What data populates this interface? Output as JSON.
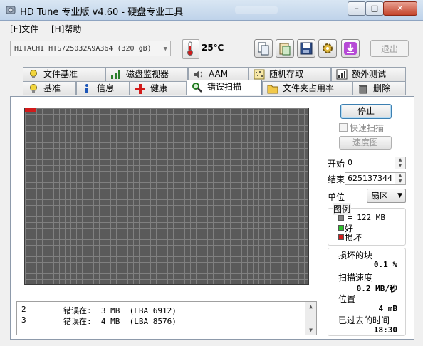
{
  "window": {
    "title": "HD Tune 专业版 v4.60 - 硬盘专业工具",
    "close_label": "✕",
    "min_label": "–",
    "max_label": "□"
  },
  "menu": [
    "[F]文件",
    "[H]帮助"
  ],
  "toolbar": {
    "drive": "HITACHI HTS725032A9A364  (320 gB)",
    "temperature": "25℃",
    "exit_label": "退出",
    "buttons": [
      {
        "icon": "copy-icon"
      },
      {
        "icon": "paste-icon"
      },
      {
        "icon": "save-icon"
      },
      {
        "icon": "options-icon"
      },
      {
        "icon": "download-icon"
      }
    ]
  },
  "tabs_top": [
    {
      "label": "文件基准",
      "icon": "info-bulb-icon"
    },
    {
      "label": "磁盘监视器",
      "icon": "monitor-chart-icon"
    },
    {
      "label": "AAM",
      "icon": "speaker-icon"
    },
    {
      "label": "随机存取",
      "icon": "random-access-icon"
    },
    {
      "label": "额外测试",
      "icon": "extra-tests-icon"
    }
  ],
  "tabs_bottom": [
    {
      "label": "基准",
      "icon": "bulb-icon"
    },
    {
      "label": "信息",
      "icon": "info-icon"
    },
    {
      "label": "健康",
      "icon": "health-cross-icon"
    },
    {
      "label": "错误扫描",
      "icon": "magnifier-icon",
      "active": true
    },
    {
      "label": "文件夹占用率",
      "icon": "folder-icon"
    },
    {
      "label": "删除",
      "icon": "trash-icon"
    }
  ],
  "scan": {
    "stop_label": "停止",
    "quick_scan_label": "快速扫描",
    "quick_scan_checked": false,
    "speed_map_label": "速度图",
    "start_label": "开始",
    "start_value": "0",
    "end_label": "结束",
    "end_value": "625137344",
    "unit_label": "单位",
    "unit_value": "扇区"
  },
  "legend": {
    "title": "图例",
    "block_size": "= 122 MB",
    "good_label": "好",
    "bad_label": "损坏",
    "colors": {
      "block": "#808080",
      "good": "#2bbf2b",
      "bad": "#d21b1b"
    }
  },
  "stats": {
    "damaged_label": "损坏的块",
    "damaged_value": "0.1 %",
    "scan_speed_label": "扫描速度",
    "scan_speed_value": "0.2 MB/秒",
    "position_label": "位置",
    "position_value": "4 mB",
    "elapsed_label": "已过去的时间",
    "elapsed_value": "18:30"
  },
  "log": [
    {
      "n": "2",
      "text": "错误在:  3 MB  (LBA 6912)"
    },
    {
      "n": "3",
      "text": "错误在:  4 MB  (LBA 8576)"
    }
  ]
}
